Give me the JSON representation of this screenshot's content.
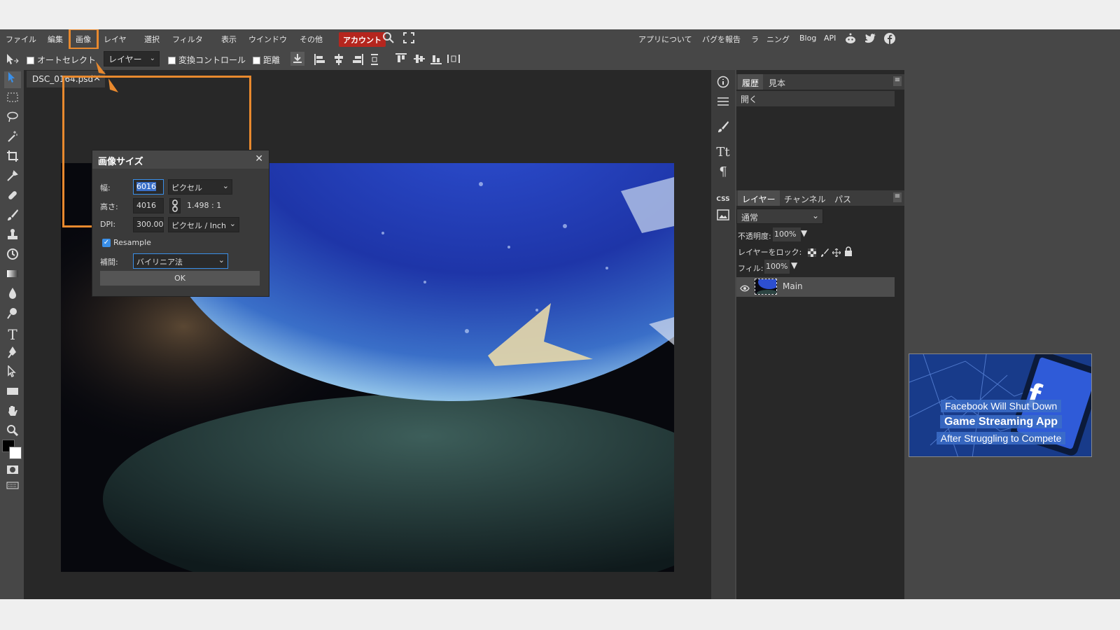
{
  "menubar": {
    "items": [
      "ファイル",
      "編集",
      "画像",
      "レイヤ",
      "選択",
      "フィルタ",
      "表示",
      "ウインドウ",
      "その他"
    ],
    "account": "アカウント",
    "right_links": [
      "アプリについて",
      "バグを報告",
      "ラ",
      "ニング",
      "Blog",
      "API"
    ],
    "social_icons": [
      "reddit-icon",
      "twitter-icon",
      "facebook-icon"
    ],
    "colors": {
      "highlight": "#e8892e",
      "account_bg": "#b5261e"
    }
  },
  "options": {
    "autoselect": "オートセレクト",
    "layer_select": "レイヤー",
    "transform_control": "変換コントロール",
    "distance": "距離"
  },
  "document": {
    "tab": "DSC_0164.psd"
  },
  "dialog": {
    "title": "画像サイズ",
    "width_label": "幅:",
    "width_value": "6016",
    "width_unit": "ピクセル",
    "height_label": "高さ:",
    "height_value": "4016",
    "ratio": "1.498 : 1",
    "dpi_label": "DPI:",
    "dpi_value": "300.00(",
    "dpi_unit": "ピクセル / Inch",
    "resample_label": "Resample",
    "interp_label": "補間:",
    "interp_value": "バイリニア法",
    "ok": "OK"
  },
  "history_panel": {
    "tabs": [
      "履歴",
      "見本"
    ],
    "items": [
      "開く"
    ]
  },
  "layers_panel": {
    "tabs": [
      "レイヤー",
      "チャンネル",
      "パス"
    ],
    "blend": "通常",
    "opacity_label": "不透明度:",
    "opacity": "100%",
    "lock_label": "レイヤーをロック:",
    "fill_label": "フィル:",
    "fill": "100%",
    "layers": [
      {
        "name": "Main"
      }
    ]
  },
  "ad": {
    "line1": "Facebook Will Shut Down",
    "line2": "Game Streaming App",
    "line3": "After Struggling to Compete"
  }
}
